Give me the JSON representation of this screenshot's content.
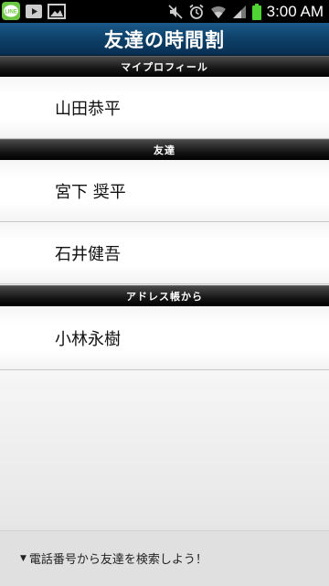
{
  "status_bar": {
    "time": "3:00 AM",
    "icons": [
      "line-app-icon",
      "play-store-icon",
      "gallery-icon",
      "mute-icon",
      "alarm-icon",
      "wifi-icon",
      "signal-icon",
      "battery-icon"
    ],
    "line_label": "LINE"
  },
  "app": {
    "title": "友達の時間割"
  },
  "sections": {
    "profile_header": "マイプロフィール",
    "friends_header": "友達",
    "address_header": "アドレス帳から"
  },
  "profile": {
    "name": "山田恭平"
  },
  "friends": [
    {
      "name": "宮下 奨平"
    },
    {
      "name": "石井健吾"
    }
  ],
  "address_book": [
    {
      "name": "小林永樹"
    }
  ],
  "footer": {
    "search_link": "電話番号から友達を検索しよう！"
  },
  "colors": {
    "title_bar": "#0d3e66",
    "section_header": "#151515",
    "battery": "#4fd334"
  }
}
